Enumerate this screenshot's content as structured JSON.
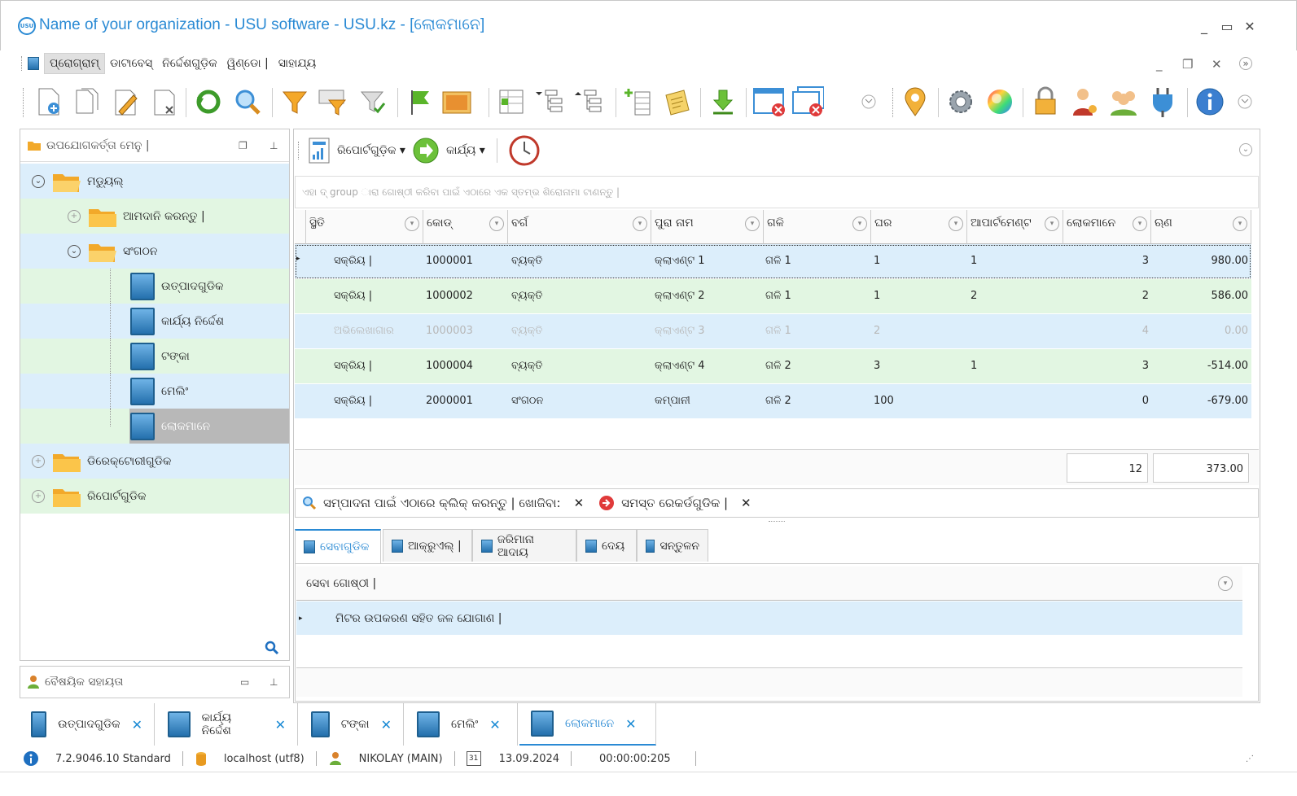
{
  "window": {
    "title": "Name of your organization - USU software - USU.kz - [ଲୋକମାନେ]",
    "app_icon_text": "USU"
  },
  "menu": {
    "items": [
      "ପ୍ରୋଗ୍ରାମ୍",
      "ଡାଟାବେସ୍",
      "ନିର୍ଦ୍ଦେଶଗୁଡ଼ିକ",
      "ୱିଣ୍ଡୋ |",
      "ସାହାଯ୍ୟ"
    ]
  },
  "left_panel": {
    "title": "ଉପଯୋଗକର୍ତ୍ତା ମେନୁ |",
    "tree": [
      {
        "label": "ମଡ୍ୟୁଲ୍"
      },
      {
        "label": "ଆମଦାନି କରନ୍ତୁ |"
      },
      {
        "label": "ସଂଗଠନ"
      },
      {
        "label": "ଉତ୍ପାଦଗୁଡିକ"
      },
      {
        "label": "କାର୍ଯ୍ୟ ନିର୍ଦ୍ଦେଶ"
      },
      {
        "label": "ଟଙ୍କା"
      },
      {
        "label": "ମେଲିଂ"
      },
      {
        "label": "ଲୋକମାନେ"
      },
      {
        "label": "ଡିରେକ୍ଟୋରୀଗୁଡିକ"
      },
      {
        "label": "ରିପୋର୍ଟଗୁଡିକ"
      }
    ],
    "bottom_title": "ବୈଷୟିକ ସହାୟତା"
  },
  "right_toolbar": {
    "reports_label": "ରିପୋର୍ଟଗୁଡ଼ିକ",
    "actions_label": "କାର୍ଯ୍ୟ"
  },
  "grid": {
    "group_hint": "ଏହା ଦ୍ group ାରା ଗୋଷ୍ଠୀ କରିବା ପାଇଁ ଏଠାରେ ଏକ ସ୍ତମ୍ଭ ଶିରୋନାମା ଟାଣନ୍ତୁ |",
    "columns": [
      "ସ୍ଥିତି",
      "କୋଡ୍",
      "ବର୍ଗ",
      "ପୁରା ନାମ",
      "ଗଳି",
      "ଘର",
      "ଆପାର୍ଟମେଣ୍ଟ",
      "ଲୋକମାନେ",
      "ଋଣ"
    ],
    "rows": [
      {
        "status": "ସକ୍ରିୟ |",
        "code": "1000001",
        "category": "ବ୍ୟକ୍ତି",
        "name": "କ୍ଲାଏଣ୍ଟ 1",
        "street": "ଗଳି 1",
        "house": "1",
        "apt": "1",
        "people": "3",
        "debt": "980.00"
      },
      {
        "status": "ସକ୍ରିୟ |",
        "code": "1000002",
        "category": "ବ୍ୟକ୍ତି",
        "name": "କ୍ଲାଏଣ୍ଟ 2",
        "street": "ଗଳି 1",
        "house": "1",
        "apt": "2",
        "people": "2",
        "debt": "586.00"
      },
      {
        "status": "ଅଭିଲେଖାଗାର",
        "code": "1000003",
        "category": "ବ୍ୟକ୍ତି",
        "name": "କ୍ଲାଏଣ୍ଟ 3",
        "street": "ଗଳି 1",
        "house": "2",
        "apt": "",
        "people": "4",
        "debt": "0.00"
      },
      {
        "status": "ସକ୍ରିୟ |",
        "code": "1000004",
        "category": "ବ୍ୟକ୍ତି",
        "name": "କ୍ଲାଏଣ୍ଟ 4",
        "street": "ଗଳି 2",
        "house": "3",
        "apt": "1",
        "people": "3",
        "debt": "-514.00"
      },
      {
        "status": "ସକ୍ରିୟ |",
        "code": "2000001",
        "category": "ସଂଗଠନ",
        "name": "କମ୍ପାନୀ",
        "street": "ଗଳି 2",
        "house": "100",
        "apt": "",
        "people": "0",
        "debt": "-679.00"
      }
    ],
    "totals": {
      "people": "12",
      "debt": "373.00"
    }
  },
  "search_bar": {
    "edit_hint": "ସମ୍ପାଦନା ପାଇଁ ଏଠାରେ କ୍ଲିକ୍ କରନ୍ତୁ | ଖୋଜିବା:",
    "all_records": "ସମସ୍ତ ରେକର୍ଡଗୁଡିକ |"
  },
  "detail_tabs": [
    "ସେବାଗୁଡିକ",
    "ଆକ୍ରୁଏଲ୍ |",
    "ଜରିମାନା ଆଦାୟ",
    "ଦେୟ",
    "ସନ୍ତୁଳନ"
  ],
  "detail_grid": {
    "column": "ସେବା ଗୋଷ୍ଠୀ |",
    "row": "ମିଟର ଉପକରଣ ସହିତ ଜଳ ଯୋଗାଣ |"
  },
  "bottom_tabs": [
    "ଉତ୍ପାଦଗୁଡିକ",
    "କାର୍ଯ୍ୟ ନିର୍ଦ୍ଦେଶ",
    "ଟଙ୍କା",
    "ମେଲିଂ",
    "ଲୋକମାନେ"
  ],
  "status_bar": {
    "version": "7.2.9046.10 Standard",
    "server": "localhost (utf8)",
    "user": "NIKOLAY (MAIN)",
    "calendar_day": "31",
    "date": "13.09.2024",
    "timer": "00:00:00:205"
  },
  "colors": {
    "accent": "#2a8ad4",
    "row_blue": "#dceefb",
    "row_green": "#e2f6e2",
    "selected_tree": "#b8b8b8"
  }
}
